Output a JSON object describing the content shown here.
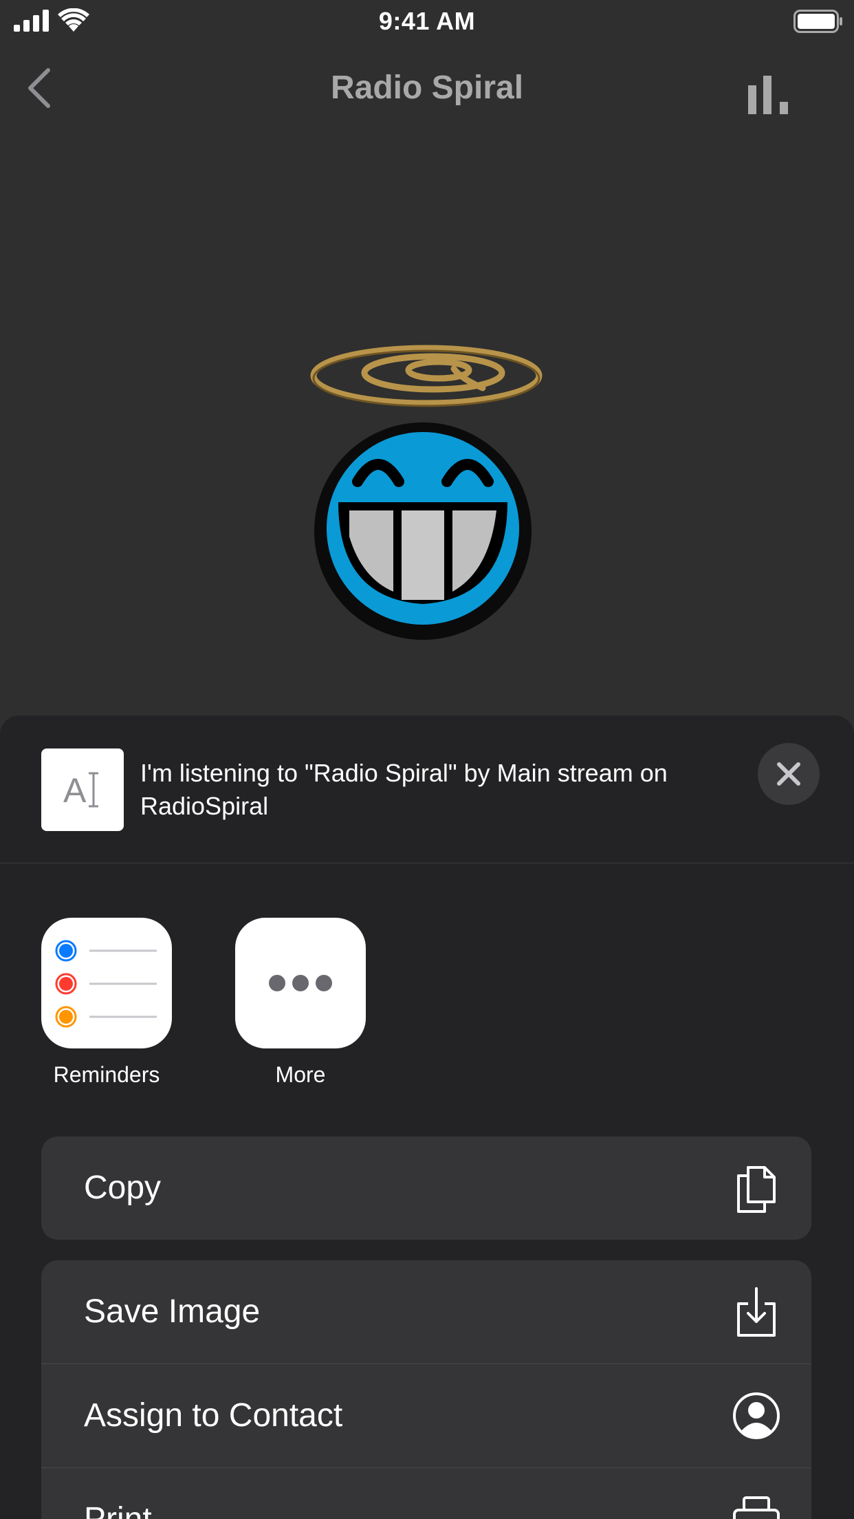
{
  "status_bar": {
    "time": "9:41 AM"
  },
  "nav": {
    "title": "Radio Spiral",
    "back_icon": "chevron-left-icon",
    "right_icon": "bar-chart-icon"
  },
  "artwork": {
    "description_icon": "radio-spiral-smiley-logo"
  },
  "share_sheet": {
    "preview_text": "I'm listening to \"Radio Spiral\" by Main stream on RadioSpiral",
    "preview_icon": "text-document-icon",
    "close_icon": "close-icon",
    "apps": [
      {
        "label": "Reminders",
        "icon": "reminders-icon"
      },
      {
        "label": "More",
        "icon": "more-icon"
      }
    ],
    "action_groups": [
      [
        {
          "label": "Copy",
          "icon": "copy-icon"
        }
      ],
      [
        {
          "label": "Save Image",
          "icon": "save-image-icon"
        },
        {
          "label": "Assign to Contact",
          "icon": "contact-icon"
        },
        {
          "label": "Print",
          "icon": "print-icon"
        }
      ]
    ]
  },
  "colors": {
    "background": "#2f2f2f",
    "sheet": "#232325",
    "row": "#353537",
    "reminder_blue": "#0a7aff",
    "reminder_red": "#ff3b30",
    "reminder_orange": "#ff9500",
    "logo_blue": "#0a9ad6",
    "logo_gold": "#b8944a"
  }
}
